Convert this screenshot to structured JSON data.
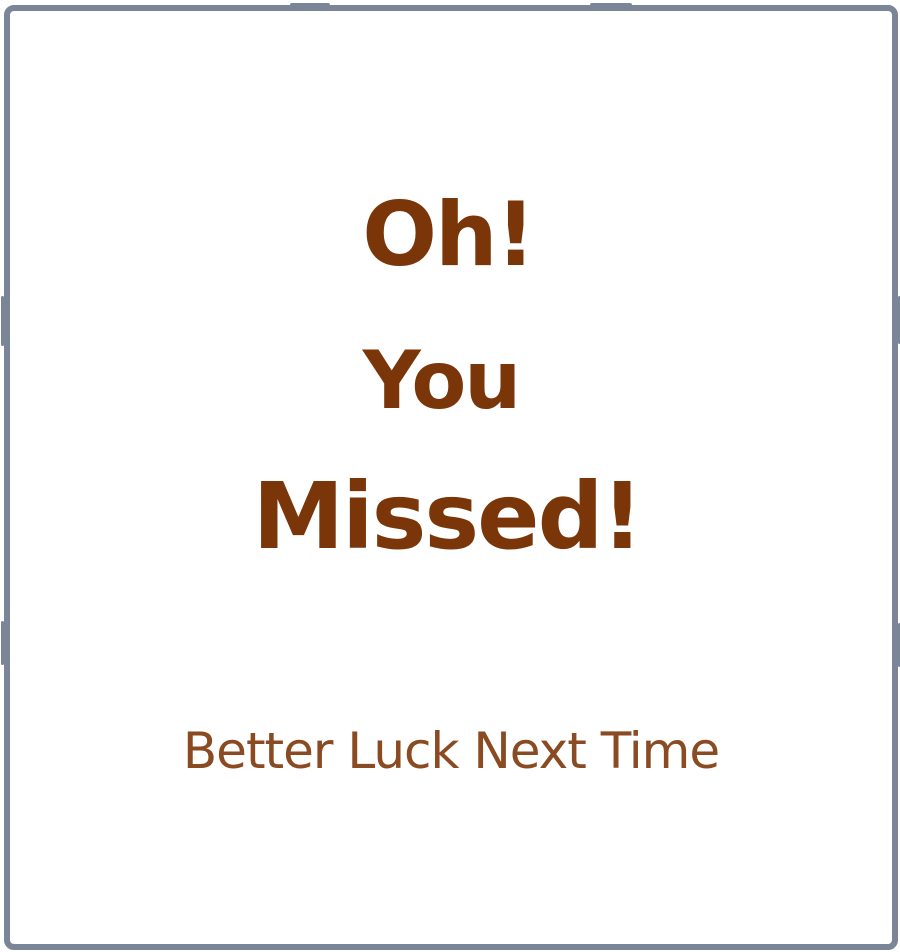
{
  "message": {
    "line1": "Oh!",
    "line2": "You",
    "line3": "Missed!",
    "subtitle": "Better Luck Next Time"
  },
  "colors": {
    "headline": "#7a3508",
    "subtitle": "#8a4a22",
    "frame": "#7a8598",
    "background": "#ffffff"
  }
}
